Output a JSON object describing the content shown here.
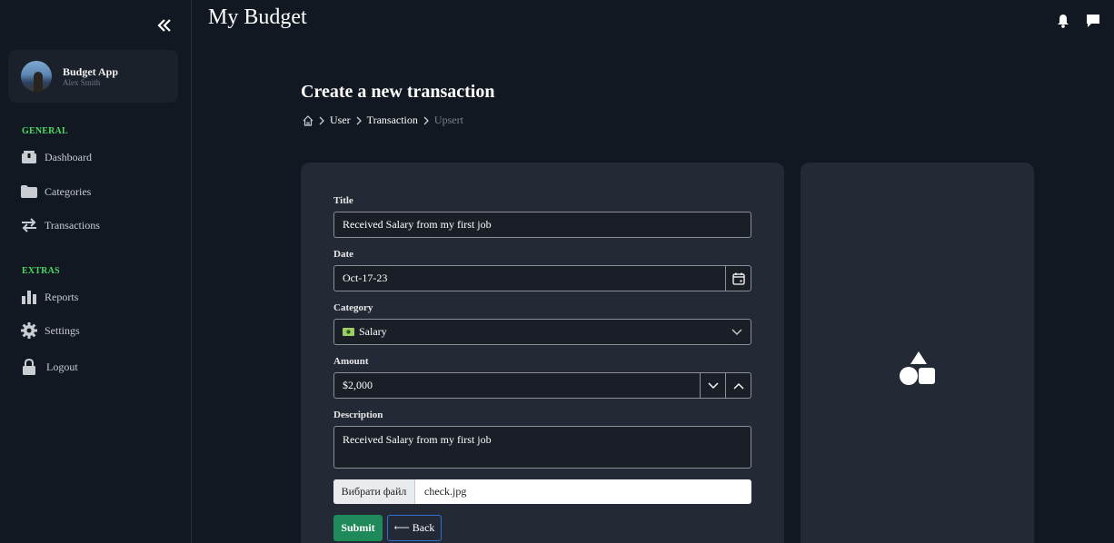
{
  "header": {
    "title": "My Budget"
  },
  "profile": {
    "name": "Budget App",
    "user": "Alex Smith"
  },
  "sidebar": {
    "general_label": "GENERAL",
    "extras_label": "EXTRAS",
    "general_items": [
      {
        "label": "Dashboard",
        "icon": "box-icon"
      },
      {
        "label": "Categories",
        "icon": "folder-icon"
      },
      {
        "label": "Transactions",
        "icon": "exchange-icon"
      }
    ],
    "extras_items": [
      {
        "label": "Reports",
        "icon": "bar-chart-icon"
      },
      {
        "label": "Settings",
        "icon": "gear-icon"
      },
      {
        "label": "Logout",
        "icon": "lock-icon"
      }
    ]
  },
  "page": {
    "title": "Create a new transaction",
    "breadcrumb": [
      "User",
      "Transaction",
      "Upsert"
    ]
  },
  "form": {
    "title_label": "Title",
    "title_value": "Received Salary from my first job",
    "date_label": "Date",
    "date_value": "Oct-17-23",
    "category_label": "Category",
    "category_value": "Salary",
    "category_icon": "💵",
    "amount_label": "Amount",
    "amount_value": "$2,000",
    "description_label": "Description",
    "description_value": "Received Salary from my first job",
    "file_button": "Вибрати файл",
    "file_name": "check.jpg",
    "submit_label": "Submit",
    "back_label": "⟵ Back"
  },
  "colors": {
    "accent_green": "#4cd964",
    "submit_bg": "#1e8a5a",
    "back_border": "#2f6fd6",
    "card_bg": "#232a36",
    "page_bg": "#121821"
  }
}
